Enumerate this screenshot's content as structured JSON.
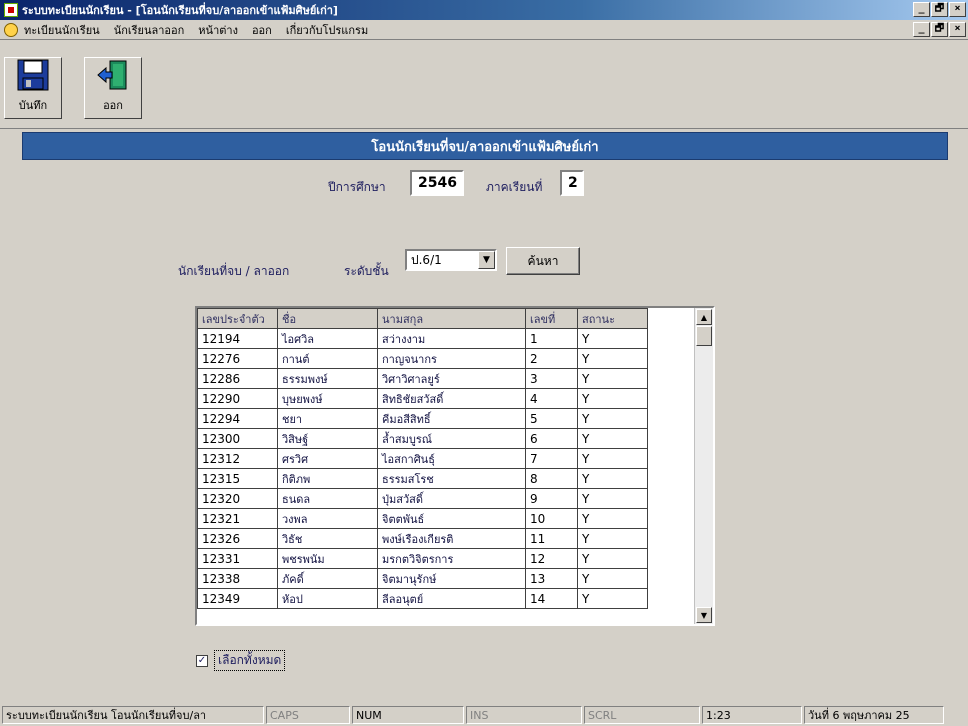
{
  "window": {
    "title": "ระบบทะเบียนนักเรียน - [โอนนักเรียนที่จบ/ลาออกเข้าแฟ้มศิษย์เก่า]",
    "buttons": {
      "minimize": "_",
      "maximize": "🗗",
      "close": "×"
    }
  },
  "menu": {
    "items": [
      "ทะเบียนนักเรียน",
      "นักเรียนลาออก",
      "หน้าต่าง",
      "ออก",
      "เกี่ยวกับโปรแกรม"
    ]
  },
  "toolbar": {
    "save_label": "บันทึก",
    "exit_label": "ออก"
  },
  "form": {
    "header": "โอนนักเรียนที่จบ/ลาออกเข้าแฟ้มศิษย์เก่า",
    "year_label": "ปีการศึกษา",
    "year_value": "2546",
    "term_label": "ภาคเรียนที่",
    "term_value": "2",
    "filter_label": "นักเรียนที่จบ / ลาออก",
    "level_label": "ระดับชั้น",
    "level_value": "ป.6/1",
    "search_label": "ค้นหา",
    "select_all_label": "เลือกทั้งหมด",
    "select_all_checked": true
  },
  "grid": {
    "columns": [
      "เลขประจำตัว",
      "ชื่อ",
      "นามสกุล",
      "เลขที่",
      "สถานะ"
    ],
    "rows": [
      [
        "12194",
        "ไอศวิล",
        "สว่างงาม",
        "1",
        "Y"
      ],
      [
        "12276",
        "กานต์",
        "กาญจนากร",
        "2",
        "Y"
      ],
      [
        "12286",
        "ธรรมพงษ์",
        "วิศาวิศาลยูร์",
        "3",
        "Y"
      ],
      [
        "12290",
        "บุษยพงษ์",
        "สิทธิชัยสวัสดิ์",
        "4",
        "Y"
      ],
      [
        "12294",
        "ชยา",
        "คีมอสีสิทธิ์",
        "5",
        "Y"
      ],
      [
        "12300",
        "วิสิษฐ์",
        "ล้ำสมบูรณ์",
        "6",
        "Y"
      ],
      [
        "12312",
        "ศรวิศ",
        "ไอสกาศินธุ์",
        "7",
        "Y"
      ],
      [
        "12315",
        "กิติภพ",
        "ธรรมสโรช",
        "8",
        "Y"
      ],
      [
        "12320",
        "ธนดล",
        "ปุ่มสวัสดิ์",
        "9",
        "Y"
      ],
      [
        "12321",
        "วงพล",
        "จิตตพันธ์",
        "10",
        "Y"
      ],
      [
        "12326",
        "วิธัช",
        "พงษ์เรืองเกียรติ",
        "11",
        "Y"
      ],
      [
        "12331",
        "พชรพนัม",
        "มรกตวิจิตรการ",
        "12",
        "Y"
      ],
      [
        "12338",
        "ภัคดิ์",
        "จิตมานุรักษ์",
        "13",
        "Y"
      ],
      [
        "12349",
        "หัอป",
        "ลีลอนุตย์",
        "14",
        "Y"
      ]
    ]
  },
  "status": {
    "message": "ระบบทะเบียนนักเรียน โอนนักเรียนที่จบ/ลา",
    "caps": "CAPS",
    "num": "NUM",
    "ins": "INS",
    "scrl": "SCRL",
    "time": "1:23",
    "date": "วันที่ 6 พฤษภาคม 25"
  }
}
